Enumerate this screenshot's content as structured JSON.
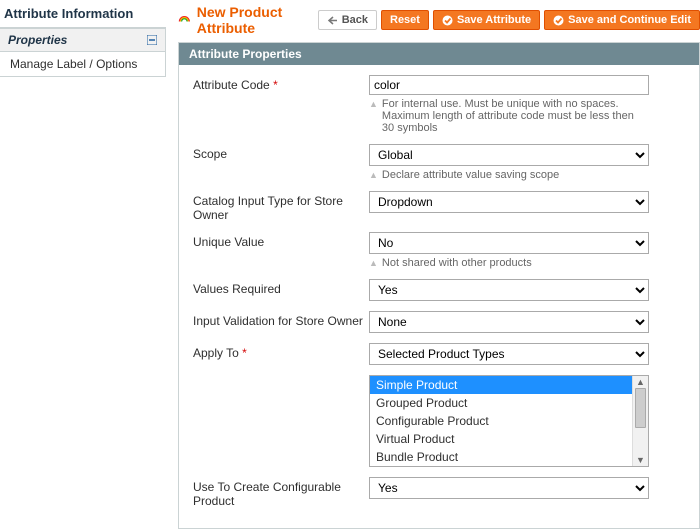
{
  "sidebar": {
    "title": "Attribute Information",
    "section_label": "Properties",
    "items": [
      {
        "label": "Manage Label / Options"
      }
    ]
  },
  "header": {
    "title": "New Product Attribute",
    "buttons": {
      "back": "Back",
      "reset": "Reset",
      "save": "Save Attribute",
      "save_continue": "Save and Continue Edit"
    }
  },
  "panel": {
    "title": "Attribute Properties"
  },
  "form": {
    "attribute_code": {
      "label": "Attribute Code",
      "value": "color",
      "note": "For internal use. Must be unique with no spaces. Maximum length of attribute code must be less then 30 symbols"
    },
    "scope": {
      "label": "Scope",
      "value": "Global",
      "note": "Declare attribute value saving scope"
    },
    "input_type": {
      "label": "Catalog Input Type for Store Owner",
      "value": "Dropdown"
    },
    "unique_value": {
      "label": "Unique Value",
      "value": "No",
      "note": "Not shared with other products"
    },
    "values_required": {
      "label": "Values Required",
      "value": "Yes"
    },
    "input_validation": {
      "label": "Input Validation for Store Owner",
      "value": "None"
    },
    "apply_to": {
      "label": "Apply To",
      "value": "Selected Product Types"
    },
    "product_types": [
      {
        "label": "Simple Product",
        "selected": true
      },
      {
        "label": "Grouped Product",
        "selected": false
      },
      {
        "label": "Configurable Product",
        "selected": false
      },
      {
        "label": "Virtual Product",
        "selected": false
      },
      {
        "label": "Bundle Product",
        "selected": false
      }
    ],
    "use_configurable": {
      "label": "Use To Create Configurable Product",
      "value": "Yes"
    }
  }
}
